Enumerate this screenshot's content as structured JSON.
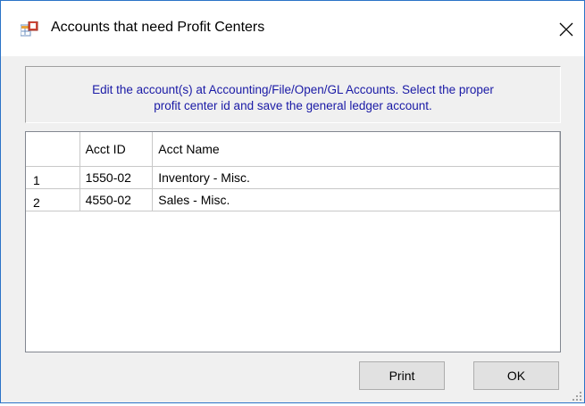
{
  "window": {
    "title": "Accounts that need Profit Centers",
    "app_icon": "table-window-icon",
    "close_icon": "close-icon"
  },
  "message": {
    "line1": "Edit the account(s) at Accounting/File/Open/GL Accounts. Select the proper",
    "line2": "profit center id and save the general ledger account."
  },
  "grid": {
    "columns": [
      "",
      "Acct ID",
      "Acct Name"
    ],
    "rows": [
      {
        "row": "1",
        "acct_id": "1550-02",
        "acct_name": "Inventory - Misc."
      },
      {
        "row": "2",
        "acct_id": "4550-02",
        "acct_name": "Sales - Misc."
      }
    ]
  },
  "buttons": {
    "print": "Print",
    "ok": "OK"
  },
  "colors": {
    "message_text": "#1a1aa6",
    "window_border": "#2b73c7",
    "dialog_background": "#f0f0f0"
  }
}
